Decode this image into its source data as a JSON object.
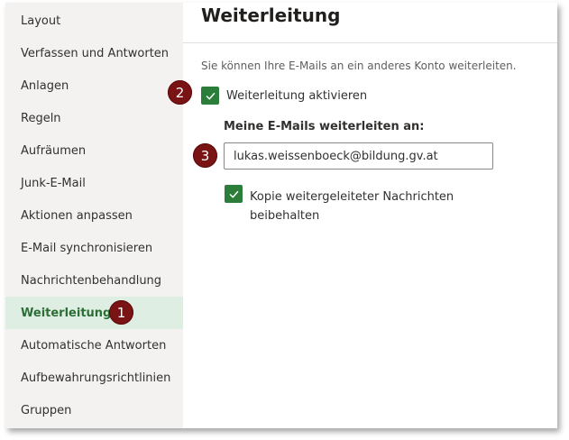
{
  "sidebar": {
    "items": [
      {
        "label": "Layout"
      },
      {
        "label": "Verfassen und Antworten"
      },
      {
        "label": "Anlagen"
      },
      {
        "label": "Regeln"
      },
      {
        "label": "Aufräumen"
      },
      {
        "label": "Junk-E-Mail"
      },
      {
        "label": "Aktionen anpassen"
      },
      {
        "label": "E-Mail synchronisieren"
      },
      {
        "label": "Nachrichtenbehandlung"
      },
      {
        "label": "Weiterleitung"
      },
      {
        "label": "Automatische Antworten"
      },
      {
        "label": "Aufbewahrungsrichtlinien"
      },
      {
        "label": "Gruppen"
      }
    ],
    "active_label": "Weiterleitung"
  },
  "main": {
    "title": "Weiterleitung",
    "intro": "Sie können Ihre E-Mails an ein anderes Konto weiterleiten.",
    "enable_forwarding": {
      "label": "Weiterleitung aktivieren",
      "checked": true
    },
    "forward_to_label": "Meine E-Mails weiterleiten an:",
    "forward_to_value": "lukas.weissenboeck@bildung.gv.at",
    "keep_copy": {
      "label_line1": "Kopie weitergeleiteter Nachrichten",
      "label_line2": "beibehalten",
      "checked": true
    }
  },
  "annotations": {
    "badge1": "1",
    "badge2": "2",
    "badge3": "3"
  },
  "colors": {
    "accent_green": "#2d7d3a",
    "active_bg": "#dfeee3",
    "badge_red": "#7a1313"
  }
}
